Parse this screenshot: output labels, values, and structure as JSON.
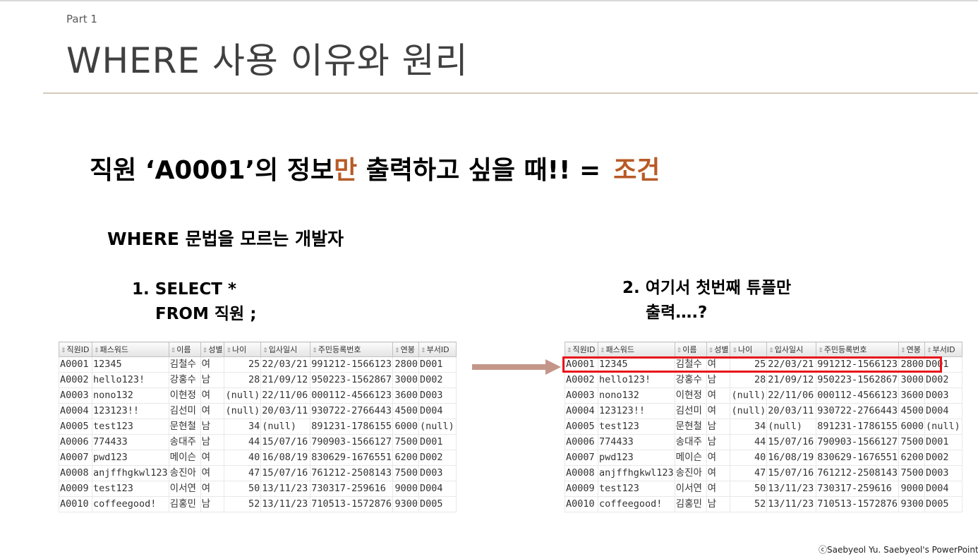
{
  "slide": {
    "part": "Part 1",
    "title": "WHERE 사용 이유와 원리",
    "headline": {
      "pre": "직원 ‘A0001’의 정보",
      "accent1": "만",
      "post": " 출력하고 싶을 때!!  =",
      "accent2": "조건"
    },
    "subhead": "WHERE 문법을 모르는 개발자",
    "step1": {
      "line1": "1. SELECT *",
      "line2": "FROM 직원 ;"
    },
    "step2": {
      "line1": "2. 여기서 첫번째 튜플만",
      "line2": "출력….?"
    },
    "footer": "ⓒSaebyeol Yu. Saebyeol's PowerPoint"
  },
  "colors": {
    "accent": "#b85a26",
    "arrow": "#c4968a",
    "highlight": "#e8141b",
    "rule": "#d6cabb"
  },
  "table": {
    "columns": [
      "직원ID",
      "패스워드",
      "이름",
      "성별",
      "나이",
      "입사일시",
      "주민등록번호",
      "연봉",
      "부서ID"
    ],
    "rows": [
      [
        "A0001",
        "12345",
        "김철수",
        "여",
        "25",
        "22/03/21",
        "991212-1566123",
        "2800",
        "D001"
      ],
      [
        "A0002",
        "hello123!",
        "강홍수",
        "남",
        "28",
        "21/09/12",
        "950223-1562867",
        "3000",
        "D002"
      ],
      [
        "A0003",
        "nono132",
        "이현정",
        "여",
        "(null)",
        "22/11/06",
        "000112-4566123",
        "3600",
        "D003"
      ],
      [
        "A0004",
        "123123!!",
        "김선미",
        "여",
        "(null)",
        "20/03/11",
        "930722-2766443",
        "4500",
        "D004"
      ],
      [
        "A0005",
        "test123",
        "문현철",
        "남",
        "34",
        "(null)",
        "891231-1786155",
        "6000",
        "(null)"
      ],
      [
        "A0006",
        "774433",
        "송대주",
        "남",
        "44",
        "15/07/16",
        "790903-1566127",
        "7500",
        "D001"
      ],
      [
        "A0007",
        "pwd123",
        "메이슨",
        "여",
        "40",
        "16/08/19",
        "830629-1676551",
        "6200",
        "D002"
      ],
      [
        "A0008",
        "anjffhgkwl123",
        "송진아",
        "여",
        "47",
        "15/07/16",
        "761212-2508143",
        "7500",
        "D003"
      ],
      [
        "A0009",
        "test123",
        "이서연",
        "여",
        "50",
        "13/11/23",
        "730317-259616",
        "9000",
        "D004"
      ],
      [
        "A0010",
        "coffeegood!",
        "김홍민",
        "남",
        "52",
        "13/11/23",
        "710513-1572876",
        "9300",
        "D005"
      ]
    ]
  }
}
